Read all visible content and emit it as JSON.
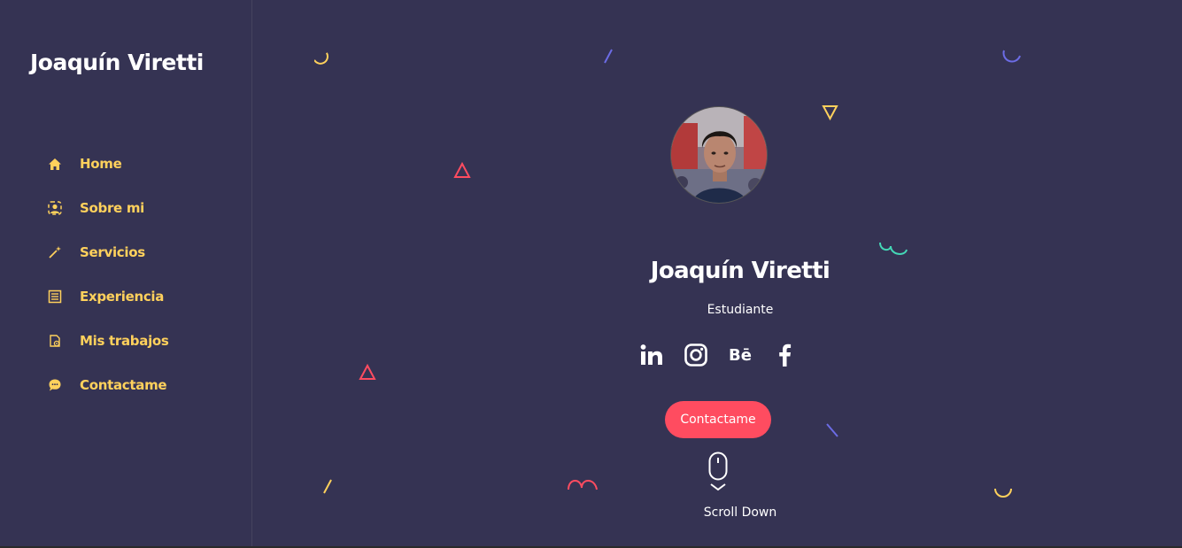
{
  "sidebar": {
    "brand": "Joaquín Viretti",
    "items": [
      {
        "label": "Home",
        "icon": "home-icon"
      },
      {
        "label": "Sobre mi",
        "icon": "user-badge-icon"
      },
      {
        "label": "Servicios",
        "icon": "magic-wand-icon"
      },
      {
        "label": "Experiencia",
        "icon": "list-icon"
      },
      {
        "label": "Mis trabajos",
        "icon": "briefcase-icon"
      },
      {
        "label": "Contactame",
        "icon": "chat-bubble-icon"
      }
    ]
  },
  "hero": {
    "name": "Joaquín Viretti",
    "role": "Estudiante",
    "social": [
      {
        "name": "linkedin-icon",
        "glyph": "in"
      },
      {
        "name": "instagram-icon",
        "glyph": ""
      },
      {
        "name": "behance-icon",
        "glyph": "Bē"
      },
      {
        "name": "facebook-icon",
        "glyph": "f"
      }
    ],
    "cta_label": "Contactame",
    "scroll_label": "Scroll Down"
  },
  "colors": {
    "background": "#353353",
    "accent_yellow": "#ffd15c",
    "accent_red": "#ff4c60",
    "accent_purple": "#6c6ce5",
    "accent_teal": "#44d7b6"
  }
}
